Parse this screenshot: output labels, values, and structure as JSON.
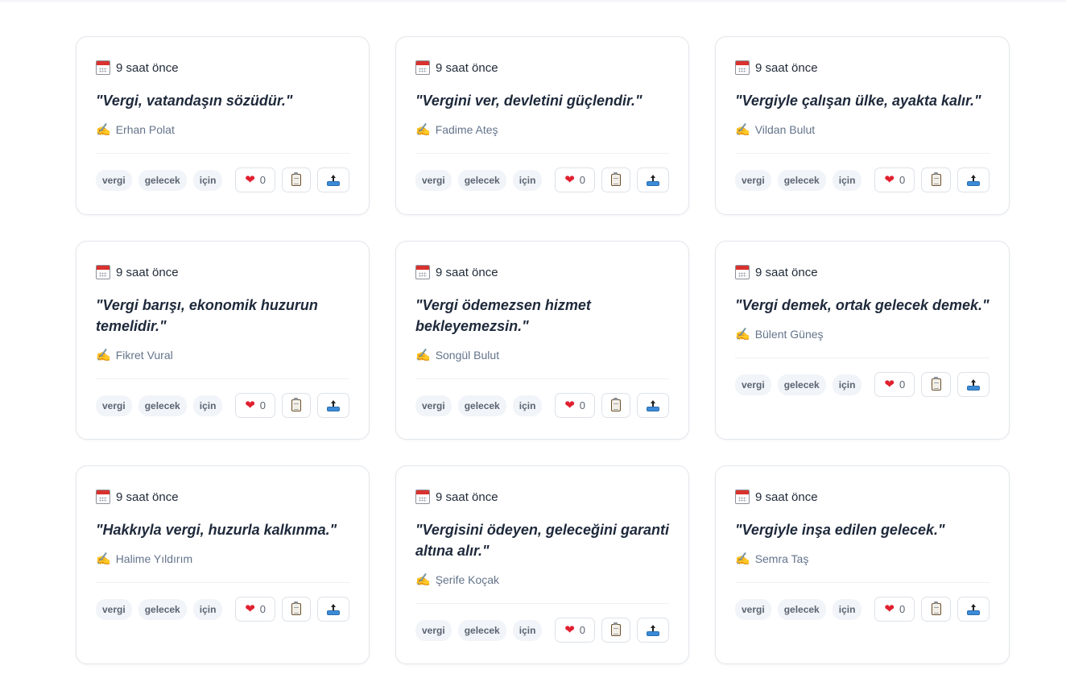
{
  "cards": [
    {
      "date": "9 saat önce",
      "quote": "\"Vergi, vatandaşın sözüdür.\"",
      "author": "Erhan Polat",
      "tags": [
        "vergi",
        "gelecek",
        "için"
      ],
      "likes": "0"
    },
    {
      "date": "9 saat önce",
      "quote": "\"Vergini ver, devletini güçlendir.\"",
      "author": "Fadime Ateş",
      "tags": [
        "vergi",
        "gelecek",
        "için"
      ],
      "likes": "0"
    },
    {
      "date": "9 saat önce",
      "quote": "\"Vergiyle çalışan ülke, ayakta kalır.\"",
      "author": "Vildan Bulut",
      "tags": [
        "vergi",
        "gelecek",
        "için"
      ],
      "likes": "0"
    },
    {
      "date": "9 saat önce",
      "quote": "\"Vergi barışı, ekonomik huzurun temelidir.\"",
      "author": "Fikret Vural",
      "tags": [
        "vergi",
        "gelecek",
        "için"
      ],
      "likes": "0"
    },
    {
      "date": "9 saat önce",
      "quote": "\"Vergi ödemezsen hizmet bekleyemezsin.\"",
      "author": "Songül Bulut",
      "tags": [
        "vergi",
        "gelecek",
        "için"
      ],
      "likes": "0"
    },
    {
      "date": "9 saat önce",
      "quote": "\"Vergi demek, ortak gelecek demek.\"",
      "author": "Bülent Güneş",
      "tags": [
        "vergi",
        "gelecek",
        "için"
      ],
      "likes": "0"
    },
    {
      "date": "9 saat önce",
      "quote": "\"Hakkıyla vergi, huzurla kalkınma.\"",
      "author": "Halime Yıldırım",
      "tags": [
        "vergi",
        "gelecek",
        "için"
      ],
      "likes": "0"
    },
    {
      "date": "9 saat önce",
      "quote": "\"Vergisini ödeyen, geleceğini garanti altına alır.\"",
      "author": "Şerife Koçak",
      "tags": [
        "vergi",
        "gelecek",
        "için"
      ],
      "likes": "0"
    },
    {
      "date": "9 saat önce",
      "quote": "\"Vergiyle inşa edilen gelecek.\"",
      "author": "Semra Taş",
      "tags": [
        "vergi",
        "gelecek",
        "için"
      ],
      "likes": "0"
    }
  ],
  "icons": {
    "date": "calendar-icon",
    "author": "writing-hand-icon",
    "like": "heart-icon",
    "copy": "clipboard-icon",
    "share": "outbox-tray-icon"
  },
  "colors": {
    "heart": "#e0202f",
    "card_border": "#e3e7ec",
    "tag_bg": "#f1f4f8",
    "muted_text": "#64748b"
  }
}
